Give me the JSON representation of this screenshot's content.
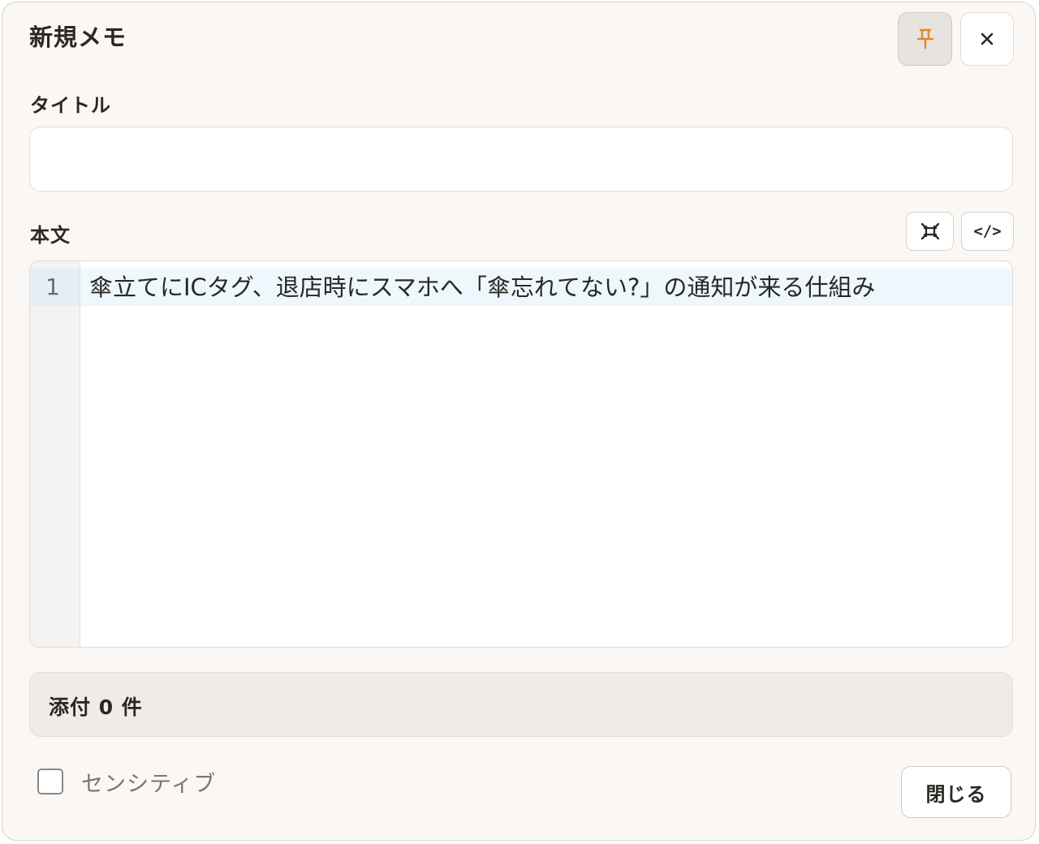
{
  "dialog": {
    "title": "新規メモ",
    "pin_icon": "pin-icon",
    "close_icon": "close-icon"
  },
  "title_field": {
    "label": "タイトル",
    "value": "",
    "placeholder": ""
  },
  "body_field": {
    "label": "本文",
    "toolbar": {
      "fullscreen_icon": "fullscreen-icon",
      "code_label": "</>"
    },
    "editor": {
      "lines": [
        {
          "number": "1",
          "text": "傘立てにICタグ、退店時にスマホへ「傘忘れてない?」の通知が来る仕組み"
        }
      ]
    }
  },
  "attachments": {
    "label": "添付 0 件"
  },
  "sensitive": {
    "label": "センシティブ",
    "checked": false
  },
  "footer": {
    "close_label": "閉じる"
  },
  "colors": {
    "pin_accent": "#e0892a",
    "active_line": "#eef8fc",
    "background": "#faf7f4"
  }
}
